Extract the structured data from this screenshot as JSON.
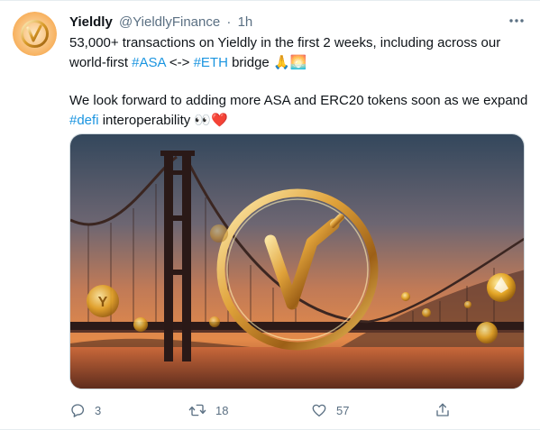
{
  "tweet": {
    "author_name": "Yieldly",
    "author_handle": "@YieldlyFinance",
    "separator": "·",
    "time": "1h",
    "line1_prefix": "53,000+ transactions on Yieldly in the first 2 weeks, including across our world-first ",
    "hashtag_asa": "#ASA",
    "line1_middle": " <-> ",
    "hashtag_eth": "#ETH",
    "line1_suffix": " bridge ",
    "line1_emoji": "🙏🌅",
    "line2_prefix": "We look forward to adding more ASA and ERC20 tokens soon as we expand ",
    "hashtag_defi": "#defi",
    "line2_suffix": " interoperability ",
    "line2_emoji": "👀❤️"
  },
  "actions": {
    "reply_count": "3",
    "retweet_count": "18",
    "like_count": "57"
  },
  "icons": {
    "more": "more-horizontal-icon",
    "reply": "reply-icon",
    "retweet": "retweet-icon",
    "like": "heart-icon",
    "share": "share-icon"
  },
  "colors": {
    "link": "#1b95e0",
    "secondary_text": "#5b7083",
    "heart": "#e0245e"
  }
}
